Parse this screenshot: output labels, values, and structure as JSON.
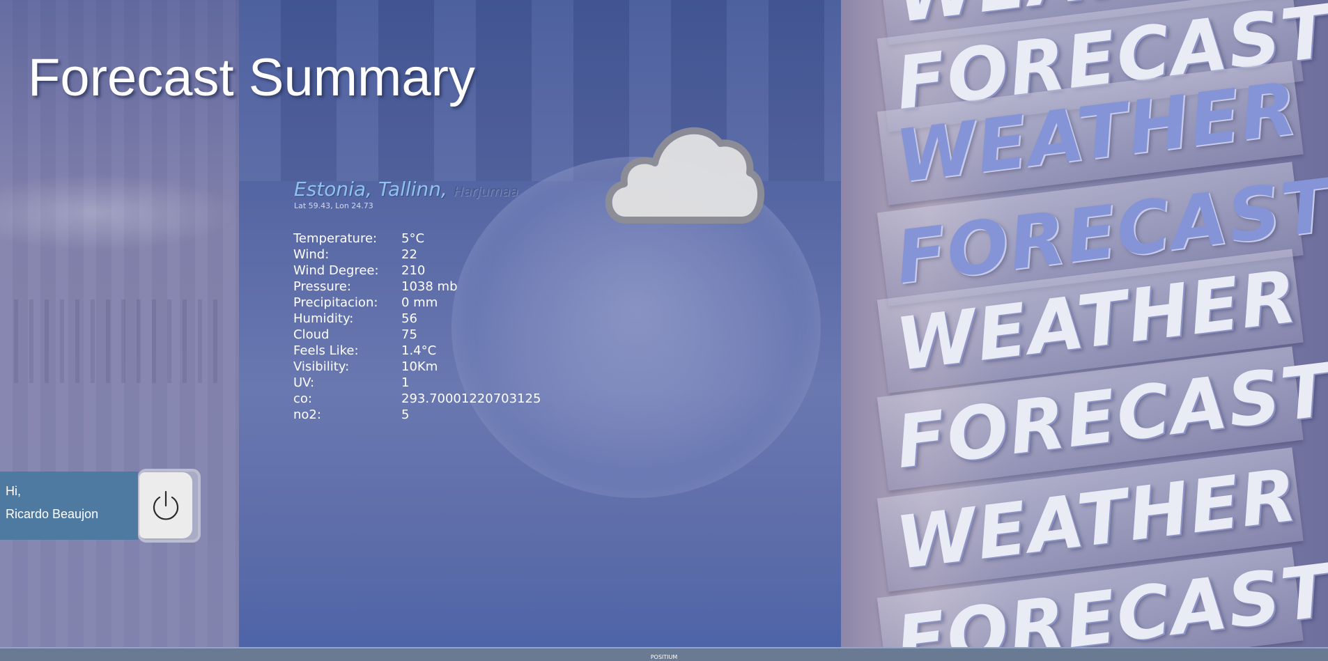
{
  "header": {
    "title": "Forecast Summary"
  },
  "location": {
    "country_city": "Estonia, Tallinn,",
    "region": "Harjumaa",
    "coordinates": "Lat 59.43, Lon 24.73"
  },
  "weather_icon": "cloud-icon",
  "stats": [
    {
      "label": "Temperature:",
      "value": "5°C"
    },
    {
      "label": "Wind:",
      "value": "22"
    },
    {
      "label": "Wind Degree:",
      "value": "210"
    },
    {
      "label": "Pressure:",
      "value": "1038 mb"
    },
    {
      "label": "Precipitacion:",
      "value": "0 mm"
    },
    {
      "label": "Humidity:",
      "value": "56"
    },
    {
      "label": "Cloud",
      "value": "75"
    },
    {
      "label": "Feels Like:",
      "value": "1.4°C"
    },
    {
      "label": "Visibility:",
      "value": "10Km"
    },
    {
      "label": "UV:",
      "value": "1"
    },
    {
      "label": "co:",
      "value": "293.70001220703125"
    },
    {
      "label": "no2:",
      "value": "5"
    }
  ],
  "user": {
    "greeting": "Hi,",
    "name": "Ricardo Beaujon"
  },
  "logout": {
    "icon": "power-icon"
  },
  "background": {
    "banners": [
      "WEATHER",
      "FORECAST",
      "WEATHER",
      "FORECAST",
      "WEATHER",
      "FORECAST",
      "WEATHER",
      "FORECAST"
    ]
  },
  "footer": {
    "label": "POSITIUM"
  },
  "colors": {
    "location_text": "#8ec3ee",
    "user_panel": "#4e7aa2",
    "center_panel": "#5566a4"
  }
}
